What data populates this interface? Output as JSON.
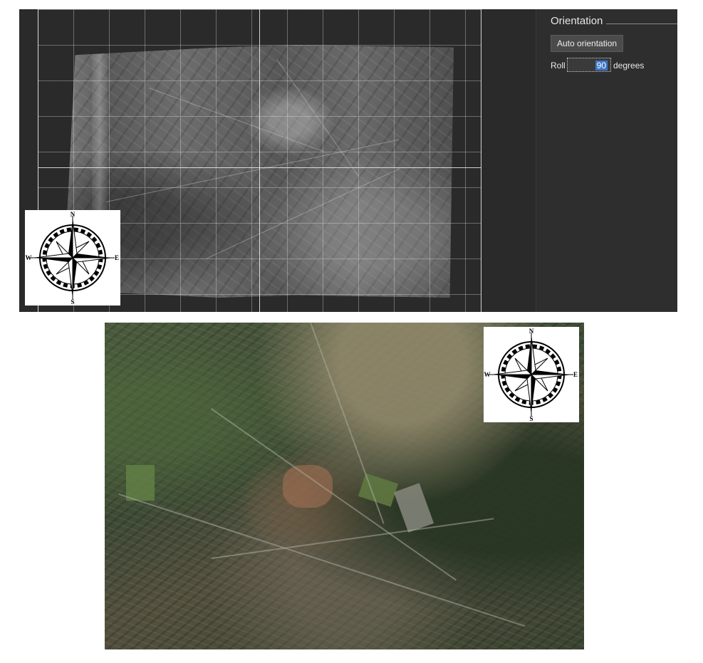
{
  "panel": {
    "title": "Orientation",
    "auto_button_label": "Auto orientation",
    "roll_label": "Roll",
    "roll_value": "90",
    "roll_unit": "degrees"
  },
  "compass": {
    "north": "N",
    "south": "S",
    "east": "E",
    "west": "W"
  },
  "colors": {
    "app_background": "#2b2b2b",
    "panel_background": "#2e2e2e",
    "selection_highlight": "#3c77c6",
    "grid_lines": "#e6e6e6"
  },
  "icons": {
    "compass_rose": "compass-rose-icon"
  }
}
